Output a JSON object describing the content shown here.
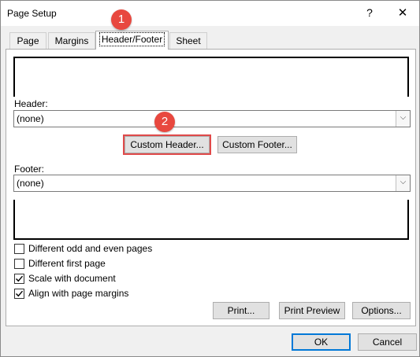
{
  "window": {
    "title": "Page Setup",
    "help_glyph": "?",
    "close_glyph": "✕"
  },
  "tabs": [
    {
      "label": "Page"
    },
    {
      "label": "Margins"
    },
    {
      "label": "Header/Footer"
    },
    {
      "label": "Sheet"
    }
  ],
  "header": {
    "label": "Header:",
    "value": "(none)"
  },
  "footer": {
    "label": "Footer:",
    "value": "(none)"
  },
  "buttons": {
    "custom_header": "Custom Header...",
    "custom_footer": "Custom Footer...",
    "print": "Print...",
    "print_preview": "Print Preview",
    "options": "Options...",
    "ok": "OK",
    "cancel": "Cancel"
  },
  "checkboxes": [
    {
      "label": "Different odd and even pages",
      "checked": false
    },
    {
      "label": "Different first page",
      "checked": false
    },
    {
      "label": "Scale with document",
      "checked": true
    },
    {
      "label": "Align with page margins",
      "checked": true
    }
  ],
  "annotations": {
    "step1": "1",
    "step2": "2"
  },
  "colors": {
    "badge": "#e8483f",
    "highlight": "#e04a4a",
    "default_button": "#0078d7"
  }
}
